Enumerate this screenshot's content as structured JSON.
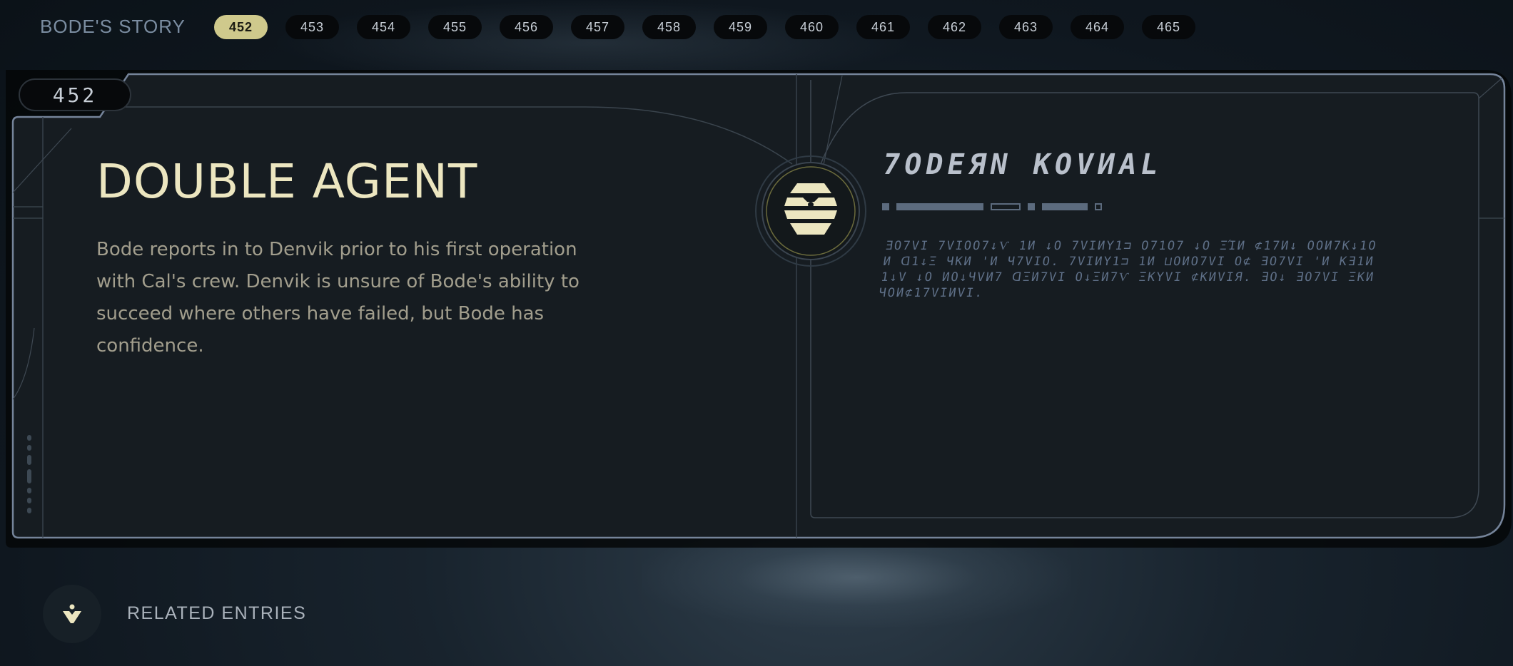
{
  "header": {
    "story_title": "BODE'S STORY",
    "tabs": [
      "452",
      "453",
      "454",
      "455",
      "456",
      "457",
      "458",
      "459",
      "460",
      "461",
      "462",
      "463",
      "464",
      "465"
    ],
    "active_tab": "452"
  },
  "entry": {
    "number": "452",
    "title": "DOUBLE AGENT",
    "description": "Bode reports in to Denvik prior to his first operation with Cal's crew. Denvik is unsure of Bode's ability to succeed where others have failed, but Bode has confidence.",
    "aurebesh_title": "7ODEЯN KOVИAL",
    "aurebesh_body": "ƎO7VI 7VIOO7↓Ѵ 1И ↓O 7VIИY1⊐ O71O7 ↓O ΞΊИ ⊄17И↓ OOИ7K↓1OИ ᗡ1↓Ξ ЧKИ 'И Ч7VIO. 7VIИY1⊐ 1И ⊔OИO7VI O⊄ ƎO7VI 'И KƎ1И1↓V ↓O ИO↓ЧVИ7 ᗡΞИ7VI O↓ΞИ7Ѵ ΞKYVI ⊄KИVIЯ. ƎO↓ ƎO7VI ΞKИ ЧOИ⊄17VIИVI."
  },
  "related": {
    "label": "RELATED ENTRIES"
  },
  "colors": {
    "accent": "#cfc98c",
    "title": "#ece6c0",
    "panel_border": "#5c6b7e",
    "background": "#0f171f"
  }
}
